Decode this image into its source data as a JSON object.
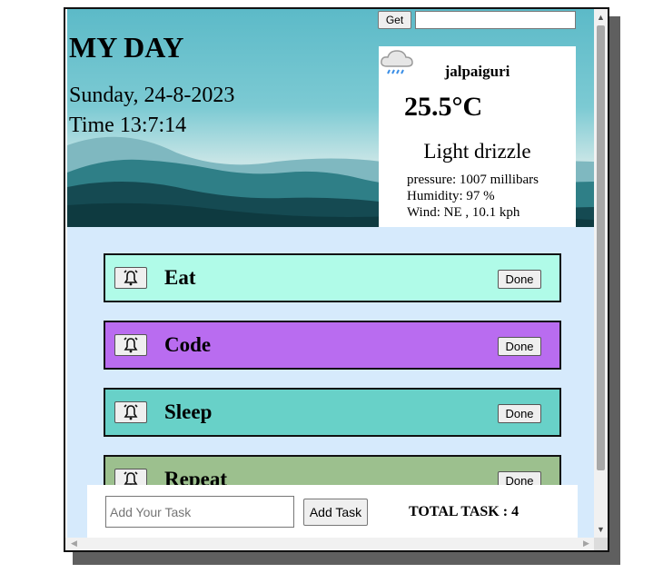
{
  "header": {
    "title": "MY DAY",
    "date": "Sunday, 24-8-2023",
    "time_label": "Time",
    "time_value": "13:7:14"
  },
  "search": {
    "button_label": "Get",
    "placeholder": "",
    "value": ""
  },
  "weather": {
    "city": "jalpaiguri",
    "temperature": "25.5°C",
    "icon": "drizzle-cloud-icon",
    "condition": "Light drizzle",
    "pressure": "pressure: 1007 millibars",
    "humidity": "Humidity: 97 %",
    "wind": "Wind: NE , 10.1 kph"
  },
  "tasks": [
    {
      "name": "Eat",
      "done_label": "Done",
      "color": "#b0fbe8"
    },
    {
      "name": "Code",
      "done_label": "Done",
      "color": "#b96cf0"
    },
    {
      "name": "Sleep",
      "done_label": "Done",
      "color": "#68d1c8"
    },
    {
      "name": "Repeat",
      "done_label": "Done",
      "color": "#9cc08e"
    }
  ],
  "footer": {
    "task_placeholder": "Add Your Task",
    "add_button_label": "Add Task",
    "total_label": "TOTAL TASK : 4"
  },
  "colors": {
    "page_background": "#d6eafc"
  }
}
